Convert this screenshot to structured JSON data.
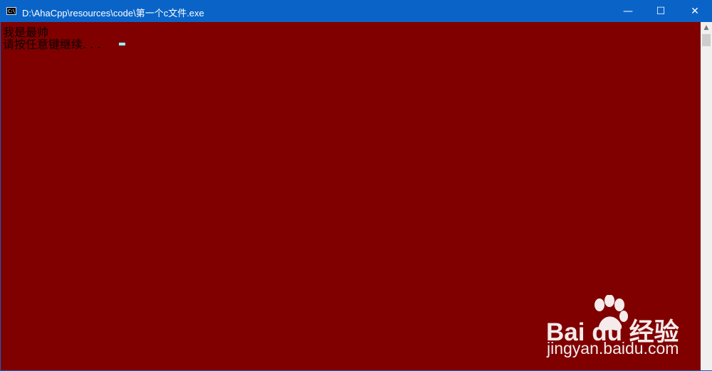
{
  "window": {
    "title": "D:\\AhaCpp\\resources\\code\\第一个c文件.exe",
    "icon": "console-app-icon",
    "controls": {
      "minimize": "—",
      "maximize": "☐",
      "close": "✕"
    }
  },
  "console": {
    "lines": [
      "我是最帅",
      "请按任意键继续. . ."
    ],
    "cursor": "_"
  },
  "scrollbar": {
    "up_arrow": "▲"
  },
  "watermark": {
    "brand": "Bai du 经验",
    "site": "jingyan.baidu.com"
  },
  "colors": {
    "titlebar": "#0a64c8",
    "console_background": "#800000",
    "console_text": "#0b0000",
    "cursor": "#8ff3ff"
  }
}
